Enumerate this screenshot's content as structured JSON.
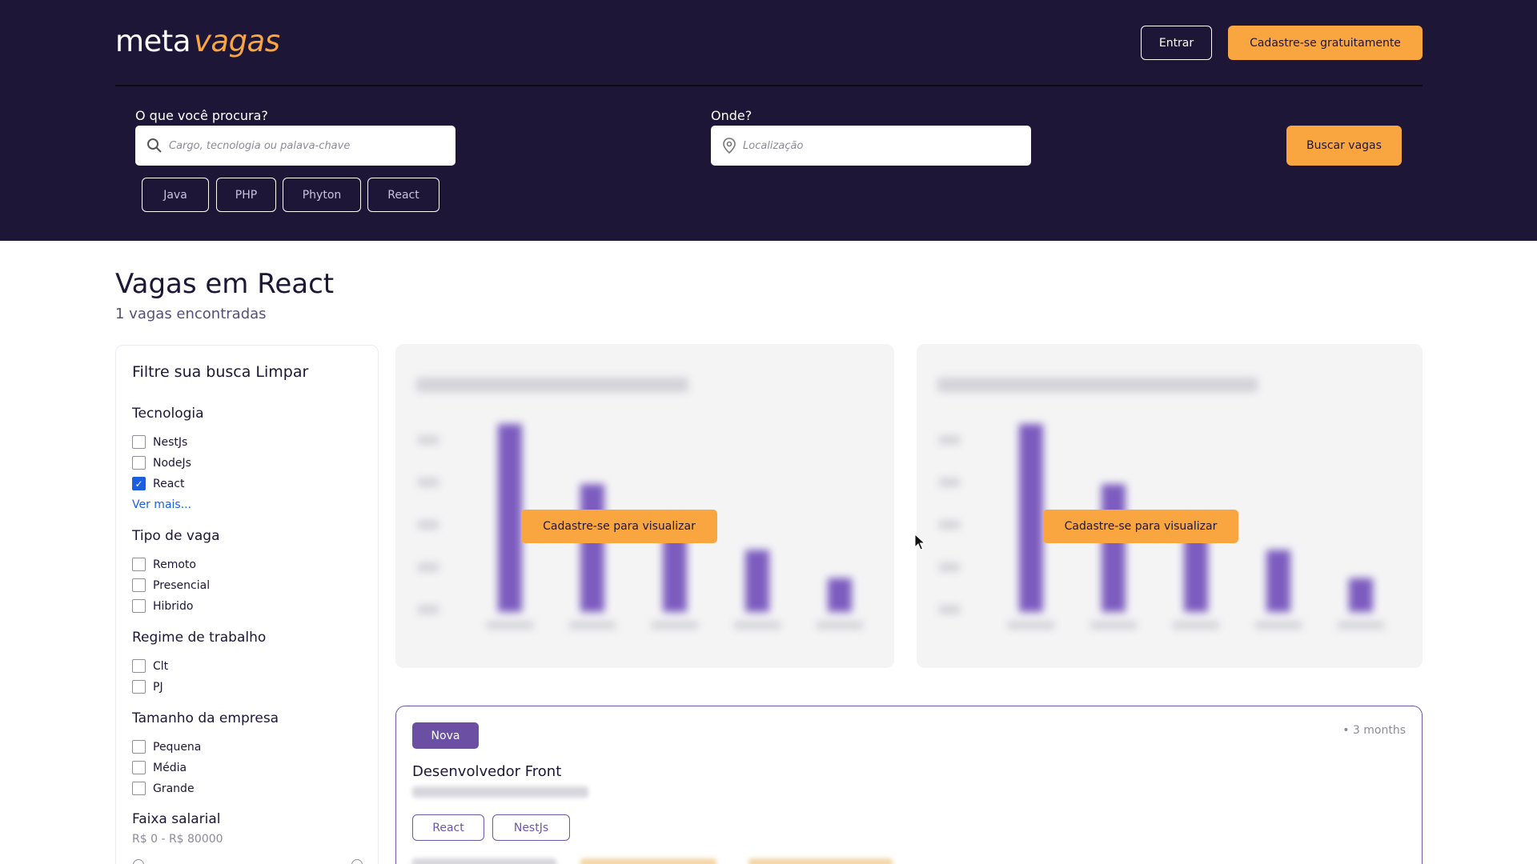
{
  "header": {
    "logo": {
      "part1": "meta",
      "part2": "vagas"
    },
    "login_label": "Entrar",
    "signup_label": "Cadastre-se gratuitamente"
  },
  "search": {
    "what_label": "O que você procura?",
    "what_placeholder": "Cargo, tecnologia ou palava-chave",
    "where_label": "Onde?",
    "where_placeholder": "Localização",
    "button_label": "Buscar vagas",
    "quick_tags": [
      "Java",
      "PHP",
      "Phyton",
      "React"
    ]
  },
  "results": {
    "title": "Vagas em React",
    "count_text": "1 vagas encontradas"
  },
  "filters": {
    "title": "Filtre sua busca Limpar",
    "sections": {
      "technology": {
        "title": "Tecnologia",
        "options": [
          {
            "label": "NestJs",
            "checked": false
          },
          {
            "label": "NodeJs",
            "checked": false
          },
          {
            "label": "React",
            "checked": true
          }
        ],
        "more_label": "Ver mais..."
      },
      "job_type": {
        "title": "Tipo de vaga",
        "options": [
          {
            "label": "Remoto",
            "checked": false
          },
          {
            "label": "Presencial",
            "checked": false
          },
          {
            "label": "Hibrido",
            "checked": false
          }
        ]
      },
      "regime": {
        "title": "Regime de trabalho",
        "options": [
          {
            "label": "Clt",
            "checked": false
          },
          {
            "label": "PJ",
            "checked": false
          }
        ]
      },
      "company_size": {
        "title": "Tamanho da empresa",
        "options": [
          {
            "label": "Pequena",
            "checked": false
          },
          {
            "label": "Média",
            "checked": false
          },
          {
            "label": "Grande",
            "checked": false
          }
        ]
      },
      "salary": {
        "title": "Faixa salarial",
        "range_text": "R$ 0 - R$ 80000"
      }
    }
  },
  "charts": {
    "cta_label": "Cadastre-se para visualizar",
    "bar_color": "#7c5cbf"
  },
  "job": {
    "badge": "Nova",
    "time": "• 3 months",
    "title": "Desenvolvedor Front",
    "tags": [
      "React",
      "NestJs"
    ]
  },
  "colors": {
    "header_bg": "#1d1637",
    "accent": "#f9a640",
    "purple": "#6b4fa3",
    "link": "#1a5fe0"
  }
}
